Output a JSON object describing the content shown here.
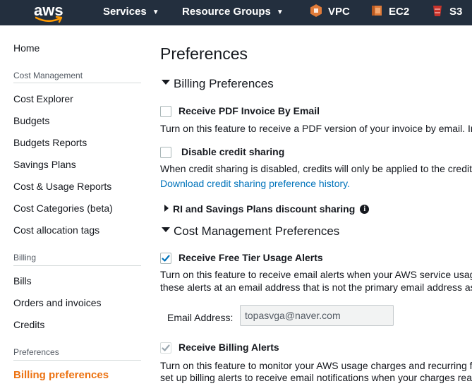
{
  "topnav": {
    "logo": "aws",
    "services": "Services",
    "resource_groups": "Resource Groups",
    "vpc": "VPC",
    "ec2": "EC2",
    "s3": "S3",
    "colors": {
      "bg": "#232f3e",
      "vpc_icon": "#e07b39",
      "ec2_icon": "#e07b39",
      "s3_icon": "#c7332b",
      "smile": "#ff9900"
    }
  },
  "sidebar": {
    "home": "Home",
    "cost_management_section": "Cost Management",
    "cost_management_items": [
      "Cost Explorer",
      "Budgets",
      "Budgets Reports",
      "Savings Plans",
      "Cost & Usage Reports",
      "Cost Categories (beta)",
      "Cost allocation tags"
    ],
    "billing_section": "Billing",
    "billing_items": [
      "Bills",
      "Orders and invoices",
      "Credits"
    ],
    "preferences_section": "Preferences",
    "active_item": "Billing preferences",
    "active_color": "#ec7211"
  },
  "main": {
    "title": "Preferences",
    "billing_prefs": {
      "heading": "Billing Preferences",
      "pdf_invoice": {
        "label": "Receive PDF Invoice By Email",
        "checked": false,
        "desc": "Turn on this feature to receive a PDF version of your invoice by email. Invoi"
      },
      "credit_sharing": {
        "label": "Disable credit sharing",
        "checked": false,
        "desc": "When credit sharing is disabled, credits will only be applied to the credit ow",
        "link": "Download credit sharing preference history."
      },
      "ri_sharing": {
        "label": "RI and Savings Plans discount sharing",
        "info_icon": "i"
      }
    },
    "cost_mgmt_prefs": {
      "heading": "Cost Management Preferences",
      "free_tier": {
        "label": "Receive Free Tier Usage Alerts",
        "checked": true,
        "desc_line1": "Turn on this feature to receive email alerts when your AWS service usage is",
        "desc_line2": "these alerts at an email address that is not the primary email address assoc"
      },
      "email": {
        "label": "Email Address:",
        "value": "topasvga@naver.com"
      },
      "billing_alerts": {
        "label": "Receive Billing Alerts",
        "checked": true,
        "disabled": true,
        "desc_line1": "Turn on this feature to monitor your AWS usage charges and recurring fee",
        "desc_line2": "set up billing alerts to receive email notifications when your charges reach"
      }
    },
    "colors": {
      "link": "#0073bb",
      "checkbox_check": "#0073bb",
      "checkbox_disabled": "#9aa7b0"
    }
  }
}
